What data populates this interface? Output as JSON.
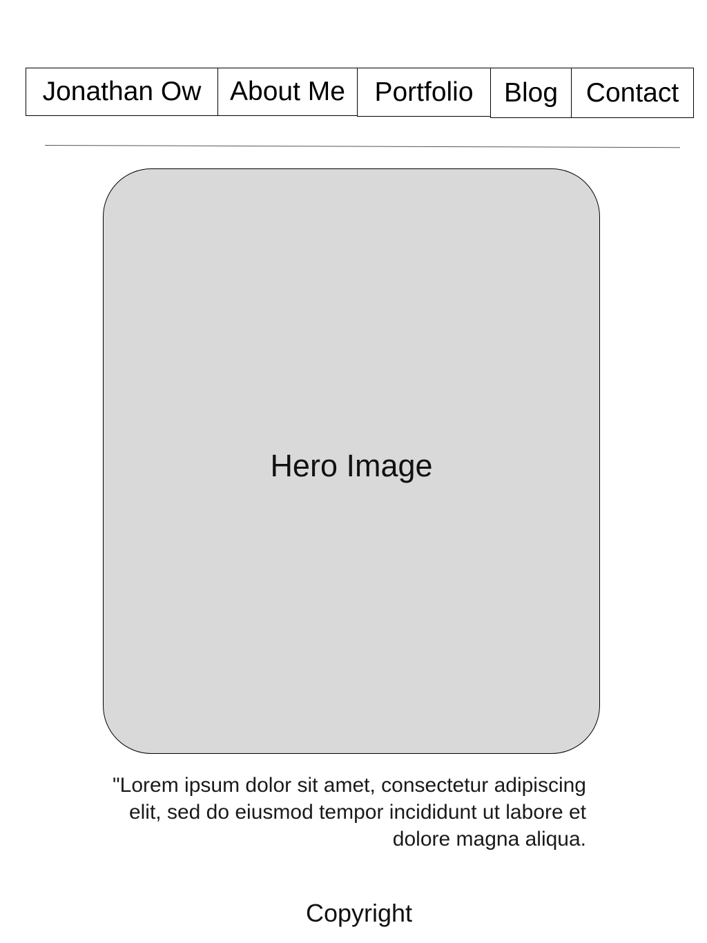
{
  "nav": {
    "brand": "Jonathan Ow",
    "about": "About Me",
    "portfolio": "Portfolio",
    "blog": "Blog",
    "contact": "Contact"
  },
  "hero": {
    "label": "Hero Image"
  },
  "quote": {
    "text": "\"Lorem ipsum dolor sit amet, consectetur adipiscing elit, sed do eiusmod tempor incididunt ut labore et dolore magna aliqua."
  },
  "footer": {
    "text": "Copyright"
  },
  "colors": {
    "hero_fill": "#d9d9d9",
    "border": "#000000",
    "background": "#ffffff"
  }
}
